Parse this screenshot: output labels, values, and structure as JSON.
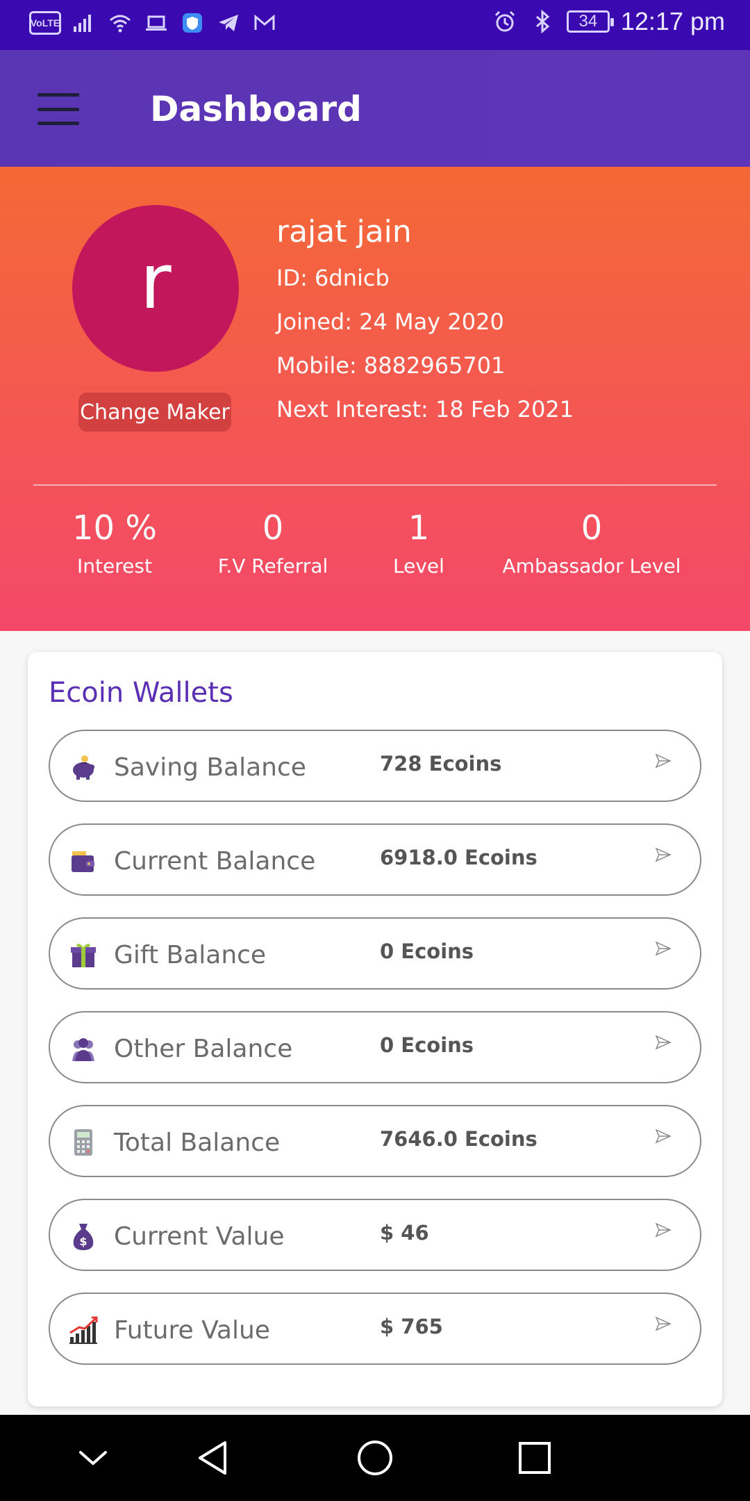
{
  "status_bar": {
    "volte": "VoLTE",
    "battery": "34",
    "time": "12:17 pm"
  },
  "app_bar": {
    "title": "Dashboard"
  },
  "profile": {
    "avatar_letter": "r",
    "badge": "Change Maker",
    "name": "rajat jain",
    "id": "ID: 6dnicb",
    "joined": "Joined: 24 May 2020",
    "mobile": "Mobile: 8882965701",
    "next_interest": "Next Interest: 18 Feb 2021",
    "stats": [
      {
        "value": "10 %",
        "label": "Interest"
      },
      {
        "value": "0",
        "label": "F.V Referral"
      },
      {
        "value": "1",
        "label": "Level"
      },
      {
        "value": "0",
        "label": "Ambassador Level"
      }
    ]
  },
  "wallets": {
    "title": "Ecoin Wallets",
    "items": [
      {
        "label": "Saving Balance",
        "value": "728 Ecoins",
        "icon": "piggy-bank-icon"
      },
      {
        "label": "Current Balance",
        "value": "6918.0 Ecoins",
        "icon": "wallet-icon"
      },
      {
        "label": "Gift Balance",
        "value": "0 Ecoins",
        "icon": "gift-icon"
      },
      {
        "label": "Other Balance",
        "value": "0 Ecoins",
        "icon": "users-icon"
      },
      {
        "label": "Total Balance",
        "value": "7646.0 Ecoins",
        "icon": "calculator-icon"
      },
      {
        "label": "Current Value",
        "value": "$ 46",
        "icon": "money-bag-icon"
      },
      {
        "label": "Future Value",
        "value": "$ 765",
        "icon": "growth-chart-icon"
      }
    ]
  },
  "colors": {
    "status_bar": "#3a0ab0",
    "app_bar": "#5e35b8",
    "profile_top": "#f46936",
    "profile_bottom": "#f4486a",
    "avatar": "#c2185b",
    "accent_title": "#5a2fb3"
  }
}
